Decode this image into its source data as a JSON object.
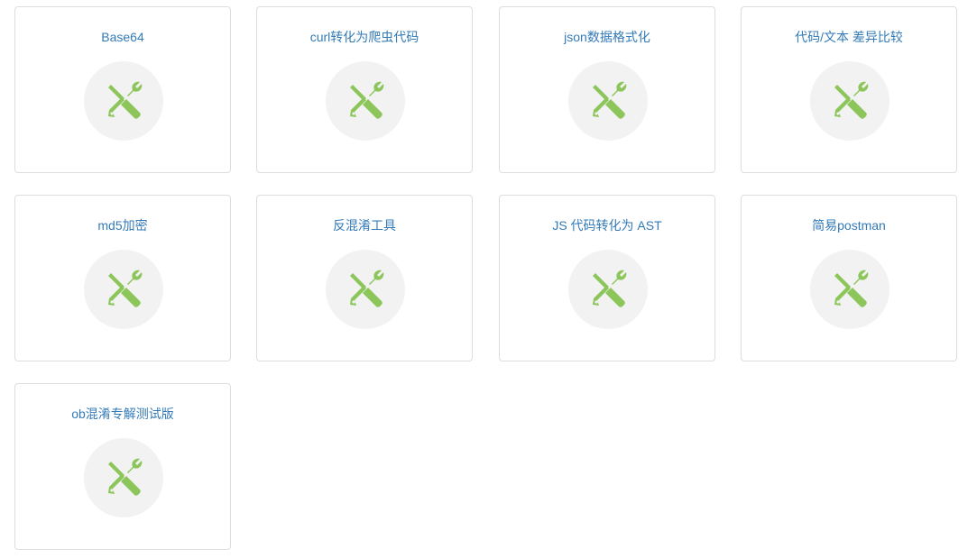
{
  "tools": [
    {
      "title": "Base64",
      "icon": "tools-icon"
    },
    {
      "title": "curl转化为爬虫代码",
      "icon": "tools-icon"
    },
    {
      "title": "json数据格式化",
      "icon": "tools-icon"
    },
    {
      "title": "代码/文本 差异比较",
      "icon": "tools-icon"
    },
    {
      "title": "md5加密",
      "icon": "tools-icon"
    },
    {
      "title": "反混淆工具",
      "icon": "tools-icon"
    },
    {
      "title": "JS 代码转化为 AST",
      "icon": "tools-icon"
    },
    {
      "title": "简易postman",
      "icon": "tools-icon"
    },
    {
      "title": "ob混淆专解测试版",
      "icon": "tools-icon"
    }
  ],
  "colors": {
    "title": "#337ab7",
    "icon": "#8cc65a",
    "icon_bg": "#f2f2f2",
    "border": "#dddddd"
  }
}
